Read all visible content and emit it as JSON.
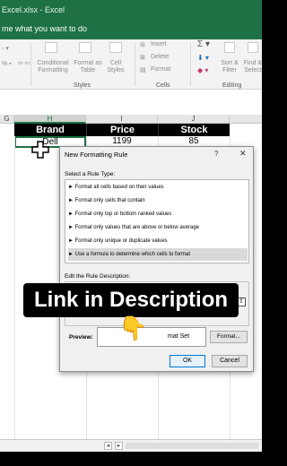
{
  "titlebar": {
    "title": "Excel.xlsx  -  Excel",
    "tell_me": "me what you want to do",
    "colors": {
      "background": "#1e7145"
    }
  },
  "ribbon": {
    "conditional_formatting": "Conditional\nFormatting",
    "format_as_table": "Format as\nTable",
    "cell_styles": "Cell\nStyles",
    "styles_group": "Styles",
    "insert": "Insert",
    "delete": "Delete",
    "format": "Format",
    "cells_group": "Cells",
    "sort_filter": "Sort &\nFilter",
    "find_select": "Find &\nSelect",
    "editing_group": "Editing"
  },
  "sheet": {
    "columns": [
      "G",
      "H",
      "I",
      "J"
    ],
    "headers": [
      "Brand",
      "Price",
      "Stock"
    ],
    "row1": {
      "brand": "Dell",
      "price": "1199",
      "stock": "85"
    }
  },
  "dialog": {
    "title": "New Formatting Rule",
    "help": "?",
    "close": "✕",
    "select_rule_type": "Select a Rule Type:",
    "rules": [
      "► Format all cells based on their values",
      "► Format only cells that contain",
      "► Format only top or bottom ranked values",
      "► Format only values that are above or below average",
      "► Format only unique or duplicate values",
      "► Use a formula to determine which cells to format"
    ],
    "selected_rule": 5,
    "edit_rule_description": "Edit the Rule Description:",
    "preview_label": "Preview:",
    "preview_text": "mat Set",
    "format_button": "Format...",
    "ok_button": "OK",
    "cancel_button": "Cancel"
  },
  "overlay": {
    "banner_text": "Link in Description",
    "emoji": "👇"
  },
  "statusbar": {
    "left_arrow": "◄",
    "right_arrow": "►"
  }
}
